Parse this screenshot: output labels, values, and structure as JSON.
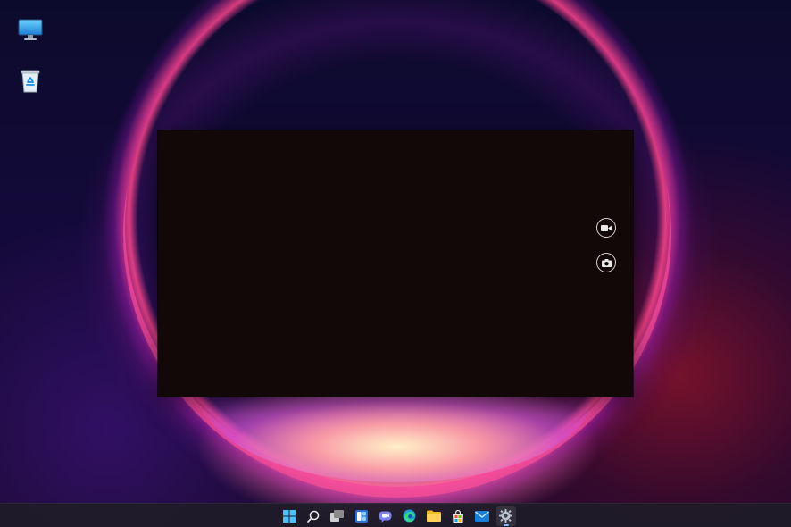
{
  "desktop": {
    "icons": [
      {
        "name": "this-pc-icon"
      },
      {
        "name": "recycle-bin-icon"
      }
    ]
  },
  "camera_app": {
    "controls": [
      {
        "name": "video-mode-icon"
      },
      {
        "name": "photo-capture-icon"
      }
    ]
  },
  "taskbar": {
    "apps": [
      {
        "name": "start-icon"
      },
      {
        "name": "search-icon"
      },
      {
        "name": "task-view-icon"
      },
      {
        "name": "widgets-icon"
      },
      {
        "name": "teams-chat-icon"
      },
      {
        "name": "edge-icon"
      },
      {
        "name": "file-explorer-icon"
      },
      {
        "name": "microsoft-store-icon"
      },
      {
        "name": "mail-icon"
      },
      {
        "name": "settings-icon",
        "active": true
      }
    ],
    "accent_color": "#7fb8ff"
  }
}
